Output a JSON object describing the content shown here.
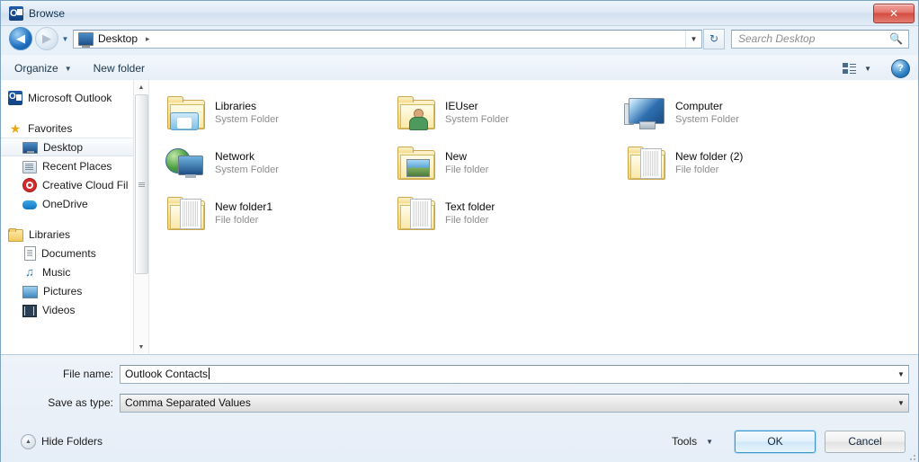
{
  "window": {
    "title": "Browse",
    "app_icon": "outlook-icon",
    "close_label": "✕"
  },
  "nav": {
    "back_glyph": "◀",
    "forward_glyph": "▶",
    "history_caret": "▼",
    "breadcrumb": {
      "icon": "desktop-icon",
      "text": "Desktop",
      "separator": "▸"
    },
    "address_caret": "▼",
    "refresh_glyph": "↻",
    "search": {
      "placeholder": "Search Desktop",
      "icon": "search-icon"
    }
  },
  "toolbar": {
    "organize_label": "Organize",
    "organize_caret": "▼",
    "new_folder_label": "New folder",
    "view_caret": "▼",
    "help_label": "?"
  },
  "sidebar": {
    "items": [
      {
        "label": "Microsoft Outlook",
        "icon": "outlook-icon",
        "level": "root",
        "selected": false
      },
      {
        "label": "Favorites",
        "icon": "star-icon",
        "level": "root",
        "selected": false
      },
      {
        "label": "Desktop",
        "icon": "desktop-icon",
        "level": "child",
        "selected": true
      },
      {
        "label": "Recent Places",
        "icon": "recent-places-icon",
        "level": "child",
        "selected": false
      },
      {
        "label": "Creative Cloud Fil",
        "icon": "creative-cloud-icon",
        "level": "child",
        "selected": false
      },
      {
        "label": "OneDrive",
        "icon": "onedrive-icon",
        "level": "child",
        "selected": false
      },
      {
        "label": "Libraries",
        "icon": "libraries-icon",
        "level": "root",
        "selected": false
      },
      {
        "label": "Documents",
        "icon": "documents-icon",
        "level": "child",
        "selected": false
      },
      {
        "label": "Music",
        "icon": "music-icon",
        "level": "child",
        "selected": false
      },
      {
        "label": "Pictures",
        "icon": "pictures-icon",
        "level": "child",
        "selected": false
      },
      {
        "label": "Videos",
        "icon": "videos-icon",
        "level": "child",
        "selected": false
      }
    ],
    "scroll_up": "▲",
    "scroll_down": "▼"
  },
  "files": [
    {
      "name": "Libraries",
      "type": "System Folder",
      "icon": "libraries-folder-icon"
    },
    {
      "name": "IEUser",
      "type": "System Folder",
      "icon": "user-folder-icon"
    },
    {
      "name": "Computer",
      "type": "System Folder",
      "icon": "computer-icon"
    },
    {
      "name": "Network",
      "type": "System Folder",
      "icon": "network-icon"
    },
    {
      "name": "New",
      "type": "File folder",
      "icon": "picture-folder-icon"
    },
    {
      "name": "New folder (2)",
      "type": "File folder",
      "icon": "documents-folder-icon"
    },
    {
      "name": "New folder1",
      "type": "File folder",
      "icon": "documents-folder-icon"
    },
    {
      "name": "Text folder",
      "type": "File folder",
      "icon": "documents-folder-icon"
    }
  ],
  "form": {
    "file_name_label": "File name:",
    "file_name_value": "Outlook Contacts",
    "save_as_type_label": "Save as type:",
    "save_as_type_value": "Comma Separated Values",
    "dropdown_caret": "▼"
  },
  "footer": {
    "hide_folders_label": "Hide Folders",
    "hide_folders_caret": "▲",
    "tools_label": "Tools",
    "tools_caret": "▼",
    "ok_label": "OK",
    "cancel_label": "Cancel"
  }
}
